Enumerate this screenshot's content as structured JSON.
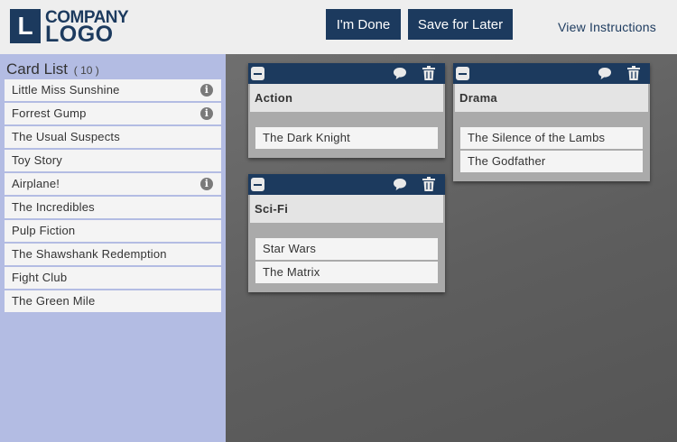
{
  "header": {
    "logo_letter": "L",
    "logo_line1": "COMPANY",
    "logo_line2": "LOGO",
    "done_label": "I'm Done",
    "save_label": "Save for Later",
    "instructions_label": "View Instructions"
  },
  "sidebar": {
    "title": "Card List",
    "count": "( 10 )",
    "cards": [
      {
        "label": "Little Miss Sunshine",
        "info": true
      },
      {
        "label": "Forrest Gump",
        "info": true
      },
      {
        "label": "The Usual Suspects",
        "info": false
      },
      {
        "label": "Toy Story",
        "info": false
      },
      {
        "label": "Airplane!",
        "info": true
      },
      {
        "label": "The Incredibles",
        "info": false
      },
      {
        "label": "Pulp Fiction",
        "info": false
      },
      {
        "label": "The Shawshank Redemption",
        "info": false
      },
      {
        "label": "Fight Club",
        "info": false
      },
      {
        "label": "The Green Mile",
        "info": false
      }
    ]
  },
  "groups": [
    {
      "title": "Action",
      "cards": [
        "The Dark Knight"
      ]
    },
    {
      "title": "Drama",
      "cards": [
        "The Silence of the Lambs",
        "The Godfather"
      ]
    },
    {
      "title": "Sci-Fi",
      "cards": [
        "Star Wars",
        "The Matrix"
      ]
    }
  ],
  "icons": {
    "info": "i"
  },
  "colors": {
    "brand_navy": "#1c3a5e",
    "sidebar_bg": "#b3bce3",
    "canvas_bg": "#636363"
  }
}
